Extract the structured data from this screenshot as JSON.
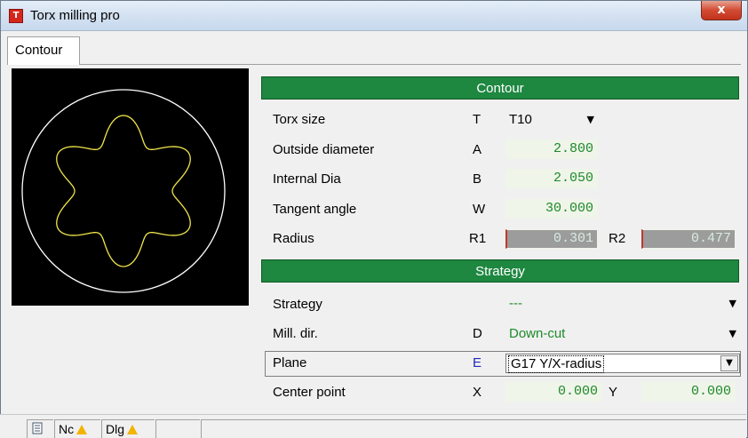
{
  "window": {
    "title": "Torx milling pro",
    "close_label": "x"
  },
  "tabs": [
    {
      "label": "Contour"
    }
  ],
  "sections": {
    "contour_title": "Contour",
    "strategy_title": "Strategy"
  },
  "contour": {
    "torx_size": {
      "label": "Torx size",
      "letter": "T",
      "value": "T10"
    },
    "outside_diameter": {
      "label": "Outside diameter",
      "letter": "A",
      "value": "2.800"
    },
    "internal_dia": {
      "label": "Internal Dia",
      "letter": "B",
      "value": "2.050"
    },
    "tangent_angle": {
      "label": "Tangent angle",
      "letter": "W",
      "value": "30.000"
    },
    "radius": {
      "label": "Radius",
      "r1_label": "R1",
      "r1_value": "0.301",
      "r2_label": "R2",
      "r2_value": "0.477"
    }
  },
  "strategy": {
    "strategy": {
      "label": "Strategy",
      "value": "---"
    },
    "mill_dir": {
      "label": "Mill. dir.",
      "letter": "D",
      "value": "Down-cut"
    },
    "plane": {
      "label": "Plane",
      "letter": "E",
      "value": "G17 Y/X-radius"
    },
    "center_point": {
      "label": "Center point",
      "x_label": "X",
      "x_value": "0.000",
      "y_label": "Y",
      "y_value": "0.000"
    }
  },
  "statusbar": {
    "nc_label": "Nc",
    "dlg_label": "Dlg"
  },
  "colors": {
    "section_band": "#1e8740",
    "value_text": "#1e8a2a",
    "preview_outer": "#ffffff",
    "preview_profile": "#f0e64a"
  }
}
